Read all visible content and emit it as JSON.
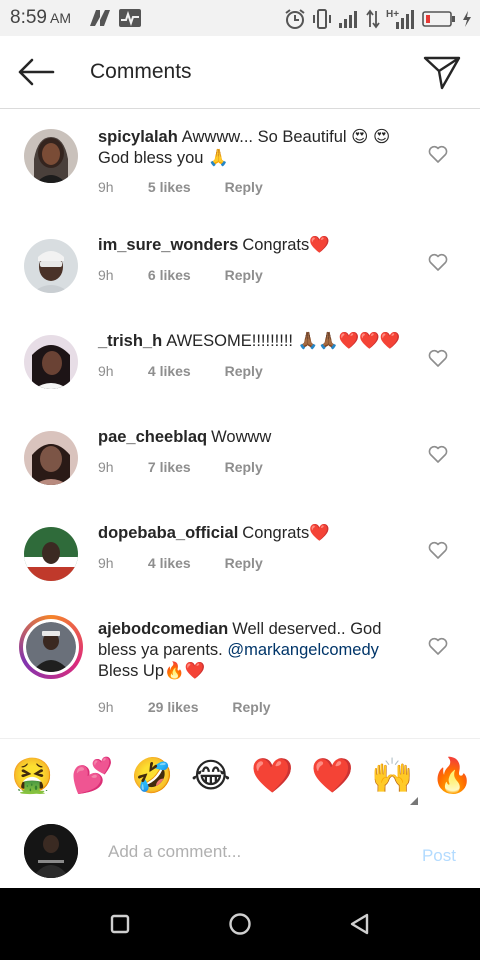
{
  "status_bar": {
    "time": "8:59",
    "ampm": "AM",
    "icons": [
      "n-app-icon",
      "pulse-app-icon",
      "alarm-icon",
      "vibrate-icon",
      "signal-icon",
      "data-arrows-icon",
      "hplus-signal-icon",
      "battery-low-icon",
      "charging-icon"
    ],
    "network_label": "H+"
  },
  "header": {
    "title": "Comments",
    "back_icon": "arrow-left-icon",
    "share_icon": "paper-plane-icon"
  },
  "comments": [
    {
      "username": "spicylalah",
      "text": "Awwww... So Beautiful 😍 😍 God bless you 🙏",
      "age": "9h",
      "likes": "5 likes",
      "reply": "Reply",
      "avatar_color": "#6b5a55"
    },
    {
      "username": "im_sure_wonders",
      "text": "Congrats❤️",
      "age": "9h",
      "likes": "6 likes",
      "reply": "Reply",
      "avatar_color": "#9aa3a8"
    },
    {
      "username": "_trish_h",
      "text": "AWESOME!!!!!!!!! 🙏🏾🙏🏾❤️❤️❤️",
      "age": "9h",
      "likes": "4 likes",
      "reply": "Reply",
      "avatar_color": "#6c5a6e"
    },
    {
      "username": "pae_cheeblaq",
      "text": "Wowww",
      "age": "9h",
      "likes": "7 likes",
      "reply": "Reply",
      "avatar_color": "#8a6a63"
    },
    {
      "username": "dopebaba_official",
      "text": "Congrats❤️",
      "age": "9h",
      "likes": "4 likes",
      "reply": "Reply",
      "avatar_color": "#3e7a45"
    },
    {
      "username": "ajebodcomedian",
      "text_before": "Well deserved.. God bless ya parents.",
      "mention": "@markangelcomedy",
      "text_after": "Bless Up🔥❤️",
      "age": "9h",
      "likes": "29 likes",
      "reply": "Reply",
      "avatar_color": "#4a4e58"
    }
  ],
  "emoji_bar": [
    "🤮",
    "💕",
    "🤣",
    "😂",
    "❤️",
    "❤️",
    "🙌",
    "🔥"
  ],
  "add_comment": {
    "placeholder": "Add a comment...",
    "post_label": "Post",
    "avatar_color": "#1a1a1a"
  },
  "nav_bar": {
    "icons": [
      "recents-square-icon",
      "home-circle-icon",
      "back-triangle-icon"
    ]
  },
  "colors": {
    "link": "#003569",
    "meta": "#8e8e8e",
    "post_disabled": "#b3dbff"
  }
}
